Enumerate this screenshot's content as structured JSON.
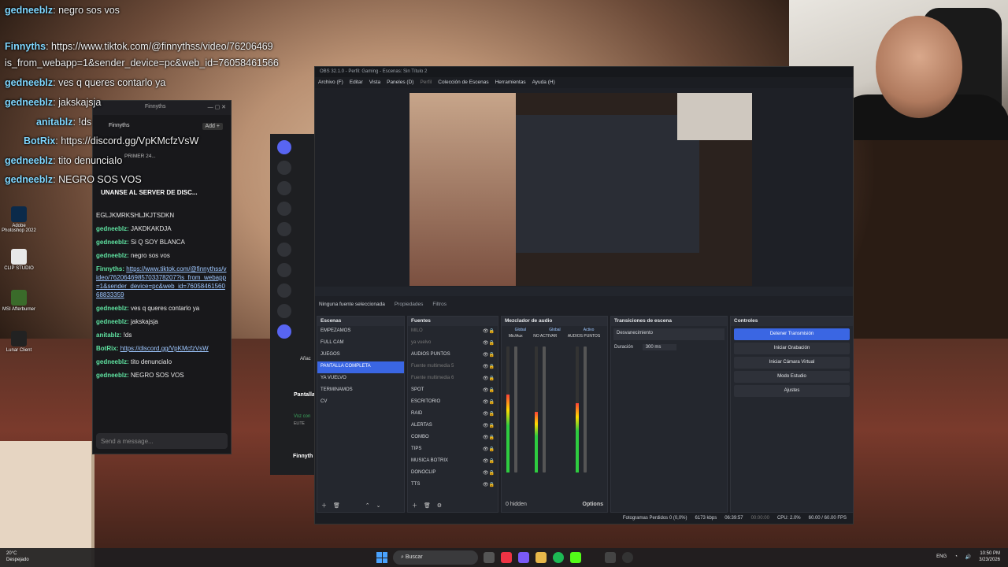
{
  "chat_overlay": {
    "lines": [
      {
        "user": "gedneeblz",
        "text": "negro sos vos"
      },
      {
        "user": "Finnyths",
        "text": "https://www.tiktok.com/@finnythss/video/76206469"
      },
      {
        "user": "",
        "text": "is_from_webapp=1&sender_device=pc&web_id=76058461566"
      },
      {
        "user": "gedneeblz",
        "text": "ves q queres contarlo ya"
      },
      {
        "user": "gedneeblz",
        "text": "jakskajsja"
      },
      {
        "user": "anitablz",
        "text": "!ds"
      },
      {
        "user": "BotRix",
        "text": "https://discord.gg/VpKMcfzVsW"
      },
      {
        "user": "gedneeblz",
        "text": "tito denunciaIo"
      },
      {
        "user": "gedneeblz",
        "text": "NEGRO SOS VOS"
      }
    ]
  },
  "desktop_icons": [
    {
      "label": "Adobe Photoshop 2022"
    },
    {
      "label": "CLIP STUDIO"
    },
    {
      "label": "MSI Afterburner"
    },
    {
      "label": "Lunar Client"
    }
  ],
  "chat_window": {
    "title": "Finnyths",
    "tab": "Finnyths",
    "add_label": "Add +",
    "pinned": "PRIMER 24...",
    "banner": "UNANSE AL SERVER DE DISC...",
    "messages": [
      {
        "user": "",
        "text": "EGLJKMRKSHLJKJTSDKN"
      },
      {
        "user": "gedneeblz:",
        "text": "JAKDKAKDJA"
      },
      {
        "user": "gedneeblz:",
        "text": "Si Q SOY BLANCA"
      },
      {
        "user": "gedneeblz:",
        "text": "negro sos vos"
      },
      {
        "user": "Finnyths:",
        "text": "https://www.tiktok.com/@finnythss/video/7620646985703378207?is_from_webapp=1&sender_device=pc&web_id=7605846156068833359"
      },
      {
        "user": "gedneeblz:",
        "text": "ves q queres contarlo ya"
      },
      {
        "user": "gedneeblz:",
        "text": "jakskajsja"
      },
      {
        "user": "anitablz:",
        "text": "!ds"
      },
      {
        "user": "BotRix:",
        "text": "https://discord.gg/VpKMcfzVsW"
      },
      {
        "user": "gedneeblz:",
        "text": "tito denunciaIo"
      },
      {
        "user": "gedneeblz:",
        "text": "NEGRO SOS VOS"
      }
    ],
    "send_placeholder": "Send a message..."
  },
  "discord": {
    "pantalla": "Pantalla",
    "voz": "Voz con",
    "elite": "ELITE",
    "user": "Finnyth",
    "anadir": "Añac"
  },
  "obs": {
    "title": "OBS 32.1.0 - Perfil: Gaming - Escenas: Sin Título 2",
    "menu": [
      "Archivo (F)",
      "Editar",
      "Vista",
      "Paneles (D)",
      "Perfil",
      "Colección de Escenas",
      "Herramientas",
      "Ayuda (H)"
    ],
    "no_source": "Ninguna fuente seleccionada",
    "properties": "Propiedades",
    "filters": "Filtros",
    "scenes": {
      "header": "Escenas",
      "items": [
        "EMPEZAMOS",
        "FULL CAM",
        "JUEGOS",
        "PANTALLA COMPLETA",
        "YA VUELVO",
        "TERMINAMOS",
        "CV"
      ],
      "selected": 3
    },
    "sources": {
      "header": "Fuentes",
      "items": [
        {
          "name": "MILO",
          "dim": true
        },
        {
          "name": "ya vuelvo",
          "dim": true
        },
        {
          "name": "AUDIOS PUNTOS",
          "dim": false
        },
        {
          "name": "Fuente multimedia 5",
          "dim": true
        },
        {
          "name": "Fuente multimedia 6",
          "dim": true
        },
        {
          "name": "SPOT",
          "dim": false
        },
        {
          "name": "ESCRITORIO",
          "dim": false
        },
        {
          "name": "RAID",
          "dim": false
        },
        {
          "name": "ALERTAS",
          "dim": false
        },
        {
          "name": "COMBO",
          "dim": false
        },
        {
          "name": "TIPS",
          "dim": false
        },
        {
          "name": "MUSICA BOTRIX",
          "dim": false
        },
        {
          "name": "DONOCLIP",
          "dim": false
        },
        {
          "name": "TTS",
          "dim": false
        }
      ]
    },
    "mixer": {
      "header": "Mezclador de audio",
      "channels": [
        "Mic/Aux",
        "NO ACTIVAR",
        "AUDIOS PUNTOS"
      ],
      "tabs": [
        "Global",
        "Global",
        "Activo"
      ],
      "levels": [
        0.62,
        0.48,
        0.55
      ],
      "hidden": "0 hidden",
      "options": "Options"
    },
    "transitions": {
      "header": "Transiciones de escena",
      "type": "Desvanecimiento",
      "duration_label": "Duración",
      "duration_value": "300 ms"
    },
    "controls": {
      "header": "Controles",
      "buttons": [
        "Detener Transmisión",
        "Iniciar Grabación",
        "Iniciar Cámara Virtual",
        "Modo Estudio",
        "Ajustes"
      ]
    },
    "status": {
      "dropped": "Fotogramas Perdidos 0 (0,0%)",
      "bitrate": "6173 kbps",
      "stream_time": "06:39:57",
      "rec_time": "00:00:00",
      "cpu": "CPU: 2.0%",
      "fps": "60.00 / 60.00 FPS"
    }
  },
  "taskbar": {
    "weather_temp": "20°C",
    "weather_desc": "Despejado",
    "search": "Buscar",
    "lang": "ENG",
    "time": "10:50 PM",
    "date": "3/23/2026"
  }
}
